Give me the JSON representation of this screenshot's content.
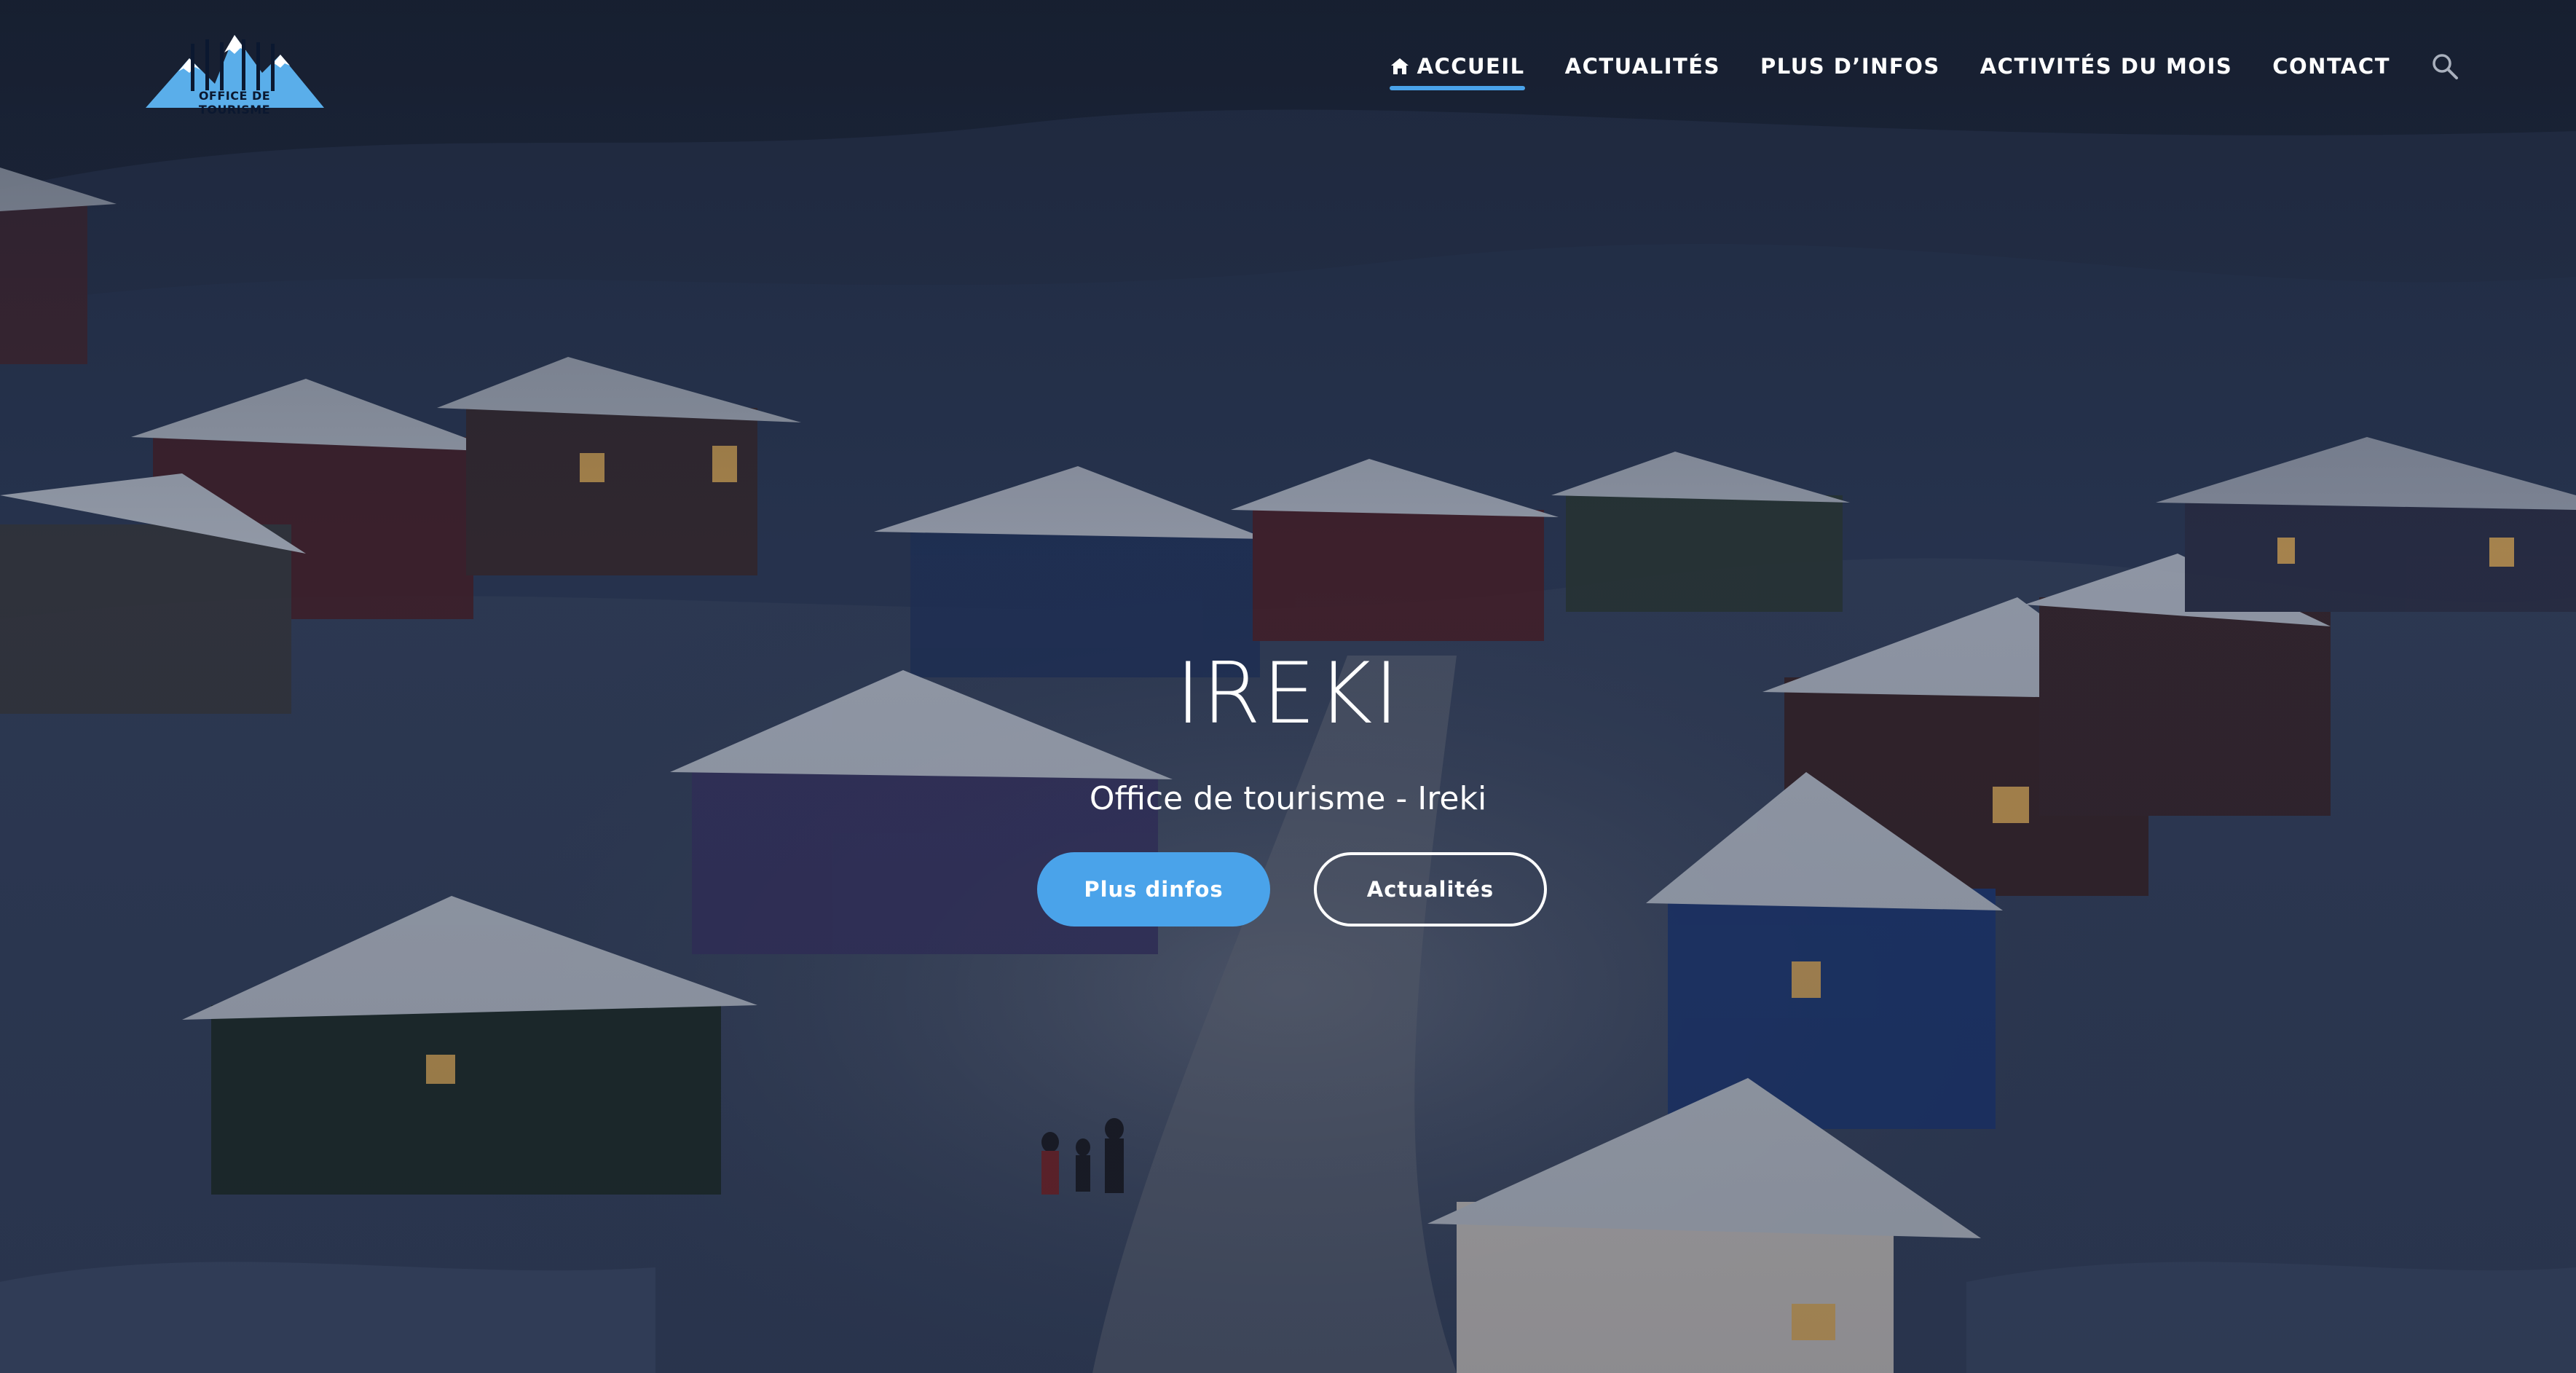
{
  "brand": {
    "logo_text": "OFFICE DE TOURISME",
    "logo_icon": "mountain-logo-icon"
  },
  "nav": {
    "items": [
      {
        "label": "ACCUEIL",
        "icon": "home-icon",
        "active": true
      },
      {
        "label": "ACTUALITÉS",
        "active": false
      },
      {
        "label": "PLUS D’INFOS",
        "active": false
      },
      {
        "label": "ACTIVITÉS DU MOIS",
        "active": false
      },
      {
        "label": "CONTACT",
        "active": false
      }
    ],
    "search_icon": "search-icon"
  },
  "hero": {
    "title": "IREKI",
    "subtitle": "Office de tourisme - Ireki",
    "primary_button": "Plus dinfos",
    "secondary_button": "Actualités"
  },
  "colors": {
    "accent": "#4aa3ea",
    "text": "#ffffff",
    "background": "#1b2538"
  }
}
